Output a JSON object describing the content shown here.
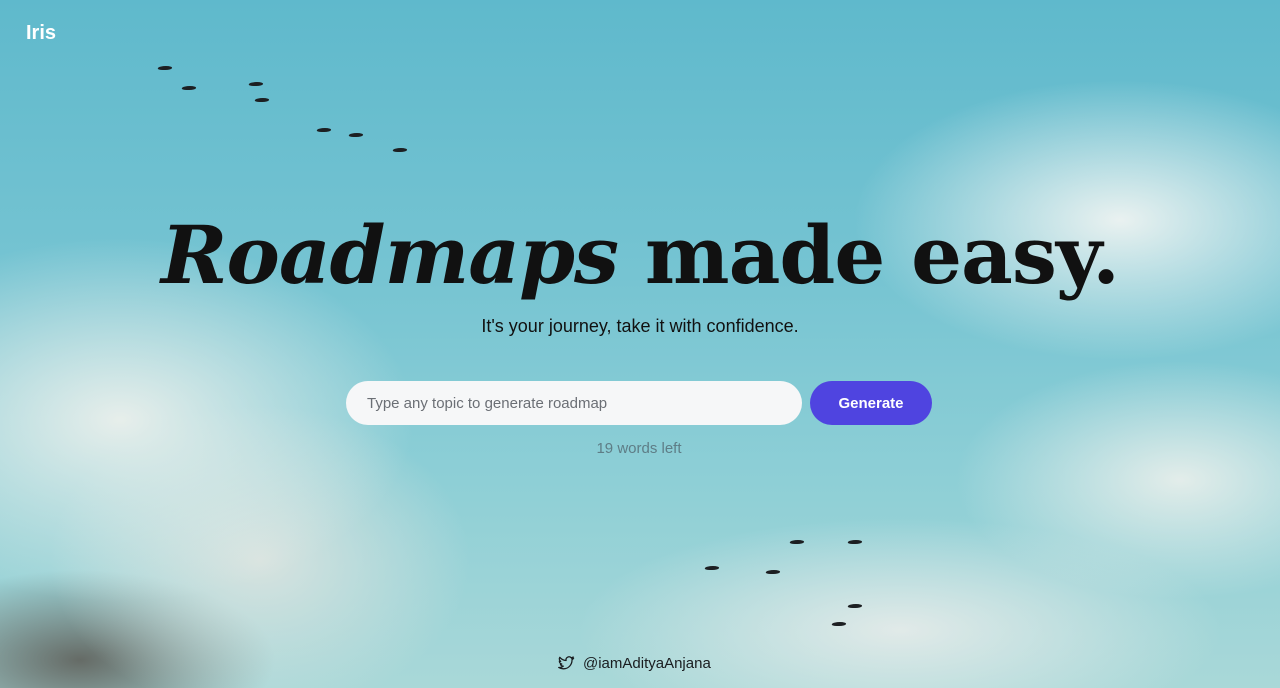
{
  "brand": {
    "name": "Iris"
  },
  "hero": {
    "headline_emphasis": "Roadmaps",
    "headline_rest": " made easy.",
    "subtitle": "It's your journey, take it with confidence."
  },
  "search": {
    "placeholder": "Type any topic to generate roadmap",
    "value": "",
    "button_label": "Generate",
    "words_left": "19 words left"
  },
  "footer": {
    "handle": "@iamAdityaAnjana",
    "icon": "twitter-icon"
  },
  "colors": {
    "accent": "#4f44e0",
    "sky": "#6cc0cf"
  }
}
